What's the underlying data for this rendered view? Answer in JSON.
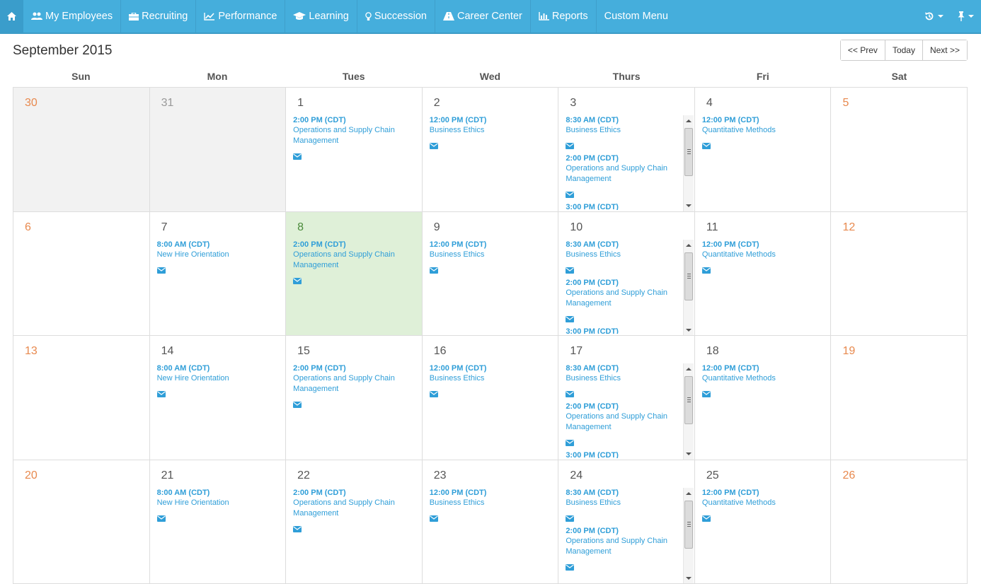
{
  "nav": {
    "items": [
      {
        "label": "My Employees",
        "icon": "users-icon"
      },
      {
        "label": "Recruiting",
        "icon": "briefcase-icon"
      },
      {
        "label": "Performance",
        "icon": "trend-chart-icon"
      },
      {
        "label": "Learning",
        "icon": "graduation-cap-icon"
      },
      {
        "label": "Succession",
        "icon": "lightbulb-icon"
      },
      {
        "label": "Career Center",
        "icon": "road-icon"
      },
      {
        "label": "Reports",
        "icon": "bar-chart-icon"
      },
      {
        "label": "Custom Menu",
        "icon": ""
      }
    ],
    "accent": "#45aedc"
  },
  "calendar": {
    "title": "September 2015",
    "buttons": {
      "prev": "<< Prev",
      "today": "Today",
      "next": "Next >>"
    },
    "weekdays": [
      "Sun",
      "Mon",
      "Tues",
      "Wed",
      "Thurs",
      "Fri",
      "Sat"
    ],
    "weeks": [
      [
        {
          "day": "30",
          "other": true,
          "weekend": true,
          "events": []
        },
        {
          "day": "31",
          "other": true,
          "events": []
        },
        {
          "day": "1",
          "events": [
            {
              "time": "2:00 PM (CDT)",
              "title": "Operations and Supply Chain Management"
            }
          ]
        },
        {
          "day": "2",
          "events": [
            {
              "time": "12:00 PM (CDT)",
              "title": "Business Ethics"
            }
          ]
        },
        {
          "day": "3",
          "scroll": true,
          "events": [
            {
              "time": "8:30 AM (CDT)",
              "title": "Business Ethics"
            },
            {
              "time": "2:00 PM (CDT)",
              "title": "Operations and Supply Chain Management"
            },
            {
              "time": "3:00 PM (CDT)",
              "title": ""
            }
          ]
        },
        {
          "day": "4",
          "events": [
            {
              "time": "12:00 PM (CDT)",
              "title": "Quantitative Methods"
            }
          ]
        },
        {
          "day": "5",
          "weekend": true,
          "events": []
        }
      ],
      [
        {
          "day": "6",
          "weekend": true,
          "events": []
        },
        {
          "day": "7",
          "events": [
            {
              "time": "8:00 AM (CDT)",
              "title": "New Hire Orientation"
            }
          ]
        },
        {
          "day": "8",
          "today": true,
          "events": [
            {
              "time": "2:00 PM (CDT)",
              "title": "Operations and Supply Chain Management"
            }
          ]
        },
        {
          "day": "9",
          "events": [
            {
              "time": "12:00 PM (CDT)",
              "title": "Business Ethics"
            }
          ]
        },
        {
          "day": "10",
          "scroll": true,
          "events": [
            {
              "time": "8:30 AM (CDT)",
              "title": "Business Ethics"
            },
            {
              "time": "2:00 PM (CDT)",
              "title": "Operations and Supply Chain Management"
            },
            {
              "time": "3:00 PM (CDT)",
              "title": ""
            }
          ]
        },
        {
          "day": "11",
          "events": [
            {
              "time": "12:00 PM (CDT)",
              "title": "Quantitative Methods"
            }
          ]
        },
        {
          "day": "12",
          "weekend": true,
          "events": []
        }
      ],
      [
        {
          "day": "13",
          "weekend": true,
          "events": []
        },
        {
          "day": "14",
          "events": [
            {
              "time": "8:00 AM (CDT)",
              "title": "New Hire Orientation"
            }
          ]
        },
        {
          "day": "15",
          "events": [
            {
              "time": "2:00 PM (CDT)",
              "title": "Operations and Supply Chain Management"
            }
          ]
        },
        {
          "day": "16",
          "events": [
            {
              "time": "12:00 PM (CDT)",
              "title": "Business Ethics"
            }
          ]
        },
        {
          "day": "17",
          "scroll": true,
          "events": [
            {
              "time": "8:30 AM (CDT)",
              "title": "Business Ethics"
            },
            {
              "time": "2:00 PM (CDT)",
              "title": "Operations and Supply Chain Management"
            },
            {
              "time": "3:00 PM (CDT)",
              "title": ""
            }
          ]
        },
        {
          "day": "18",
          "events": [
            {
              "time": "12:00 PM (CDT)",
              "title": "Quantitative Methods"
            }
          ]
        },
        {
          "day": "19",
          "weekend": true,
          "events": []
        }
      ],
      [
        {
          "day": "20",
          "weekend": true,
          "events": []
        },
        {
          "day": "21",
          "events": [
            {
              "time": "8:00 AM (CDT)",
              "title": "New Hire Orientation"
            }
          ]
        },
        {
          "day": "22",
          "events": [
            {
              "time": "2:00 PM (CDT)",
              "title": "Operations and Supply Chain Management"
            }
          ]
        },
        {
          "day": "23",
          "events": [
            {
              "time": "12:00 PM (CDT)",
              "title": "Business Ethics"
            }
          ]
        },
        {
          "day": "24",
          "scroll": true,
          "events": [
            {
              "time": "8:30 AM (CDT)",
              "title": "Business Ethics"
            },
            {
              "time": "2:00 PM (CDT)",
              "title": "Operations and Supply Chain Management"
            }
          ]
        },
        {
          "day": "25",
          "events": [
            {
              "time": "12:00 PM (CDT)",
              "title": "Quantitative Methods"
            }
          ]
        },
        {
          "day": "26",
          "weekend": true,
          "events": []
        }
      ]
    ],
    "colors": {
      "event": "#2f9ed8",
      "weekend": "#e8894e",
      "today_bg": "#dff0d8",
      "other_month_bg": "#f2f2f2"
    }
  }
}
